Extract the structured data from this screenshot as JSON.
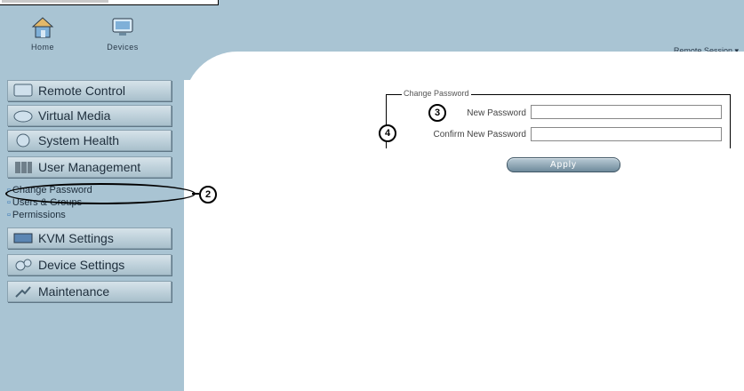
{
  "header": {
    "home_label": "Home",
    "devices_label": "Devices",
    "user_label": "Remote Session"
  },
  "sidebar": {
    "items": [
      {
        "label": "Remote Control"
      },
      {
        "label": "Virtual Media"
      },
      {
        "label": "System Health"
      },
      {
        "label": "User Management"
      },
      {
        "label": "KVM Settings"
      },
      {
        "label": "Device Settings"
      },
      {
        "label": "Maintenance"
      }
    ],
    "submenu": [
      {
        "label": "Change Password"
      },
      {
        "label": "Users & Groups"
      },
      {
        "label": "Permissions"
      }
    ]
  },
  "form": {
    "group_title": "Change Password",
    "new_password_label": "New Password",
    "confirm_password_label": "Confirm New Password",
    "apply_label": "Apply"
  },
  "callouts": {
    "c2": "2",
    "c3": "3",
    "c4": "4"
  },
  "colors": {
    "sidebar_bg": "#a9c4d3",
    "content_bg": "#ffffff"
  }
}
